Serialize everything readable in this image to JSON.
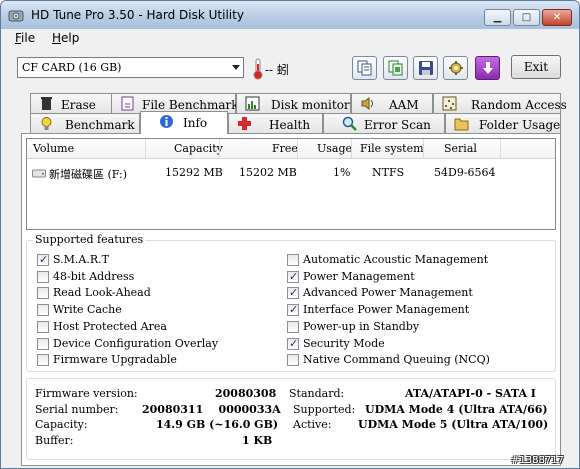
{
  "window": {
    "title": "HD Tune Pro 3.50 - Hard Disk Utility"
  },
  "menu": [
    {
      "label": "File",
      "key": "F",
      "rest": "ile"
    },
    {
      "label": "Help",
      "key": "H",
      "rest": "elp"
    }
  ],
  "toolbar": {
    "drive": "CF CARD (16 GB)",
    "temperature": "-- 蚓",
    "exit_label": "Exit",
    "buttons": [
      "copy-info-icon",
      "copy-screen-icon",
      "save-icon",
      "options-icon",
      "download-icon"
    ]
  },
  "tabs": {
    "row1": [
      {
        "label": "Erase",
        "icon": "trash-icon"
      },
      {
        "label": "File Benchmark",
        "icon": "file-benchmark-icon"
      },
      {
        "label": "Disk monitor",
        "icon": "disk-monitor-icon"
      },
      {
        "label": "AAM",
        "icon": "speaker-icon"
      },
      {
        "label": "Random Access",
        "icon": "random-access-icon"
      }
    ],
    "row2": [
      {
        "label": "Benchmark",
        "icon": "lightbulb-icon"
      },
      {
        "label": "Info",
        "icon": "info-icon",
        "active": true
      },
      {
        "label": "Health",
        "icon": "health-cross-icon"
      },
      {
        "label": "Error Scan",
        "icon": "magnifier-icon"
      },
      {
        "label": "Folder Usage",
        "icon": "folder-icon"
      }
    ]
  },
  "volumes": {
    "headers": [
      "Volume",
      "Capacity",
      "Free",
      "Usage",
      "File system",
      "Serial"
    ],
    "rows": [
      {
        "volume": "新增磁碟區 (F:)",
        "capacity": "15292 MB",
        "free": "15202 MB",
        "usage": "1%",
        "fs": "NTFS",
        "serial": "54D9-6564"
      }
    ]
  },
  "features": {
    "title": "Supported features",
    "left": [
      {
        "label": "S.M.A.R.T",
        "checked": true
      },
      {
        "label": "48-bit Address",
        "checked": false
      },
      {
        "label": "Read Look-Ahead",
        "checked": false
      },
      {
        "label": "Write Cache",
        "checked": false
      },
      {
        "label": "Host Protected Area",
        "checked": false
      },
      {
        "label": "Device Configuration Overlay",
        "checked": false
      },
      {
        "label": "Firmware Upgradable",
        "checked": false
      }
    ],
    "right": [
      {
        "label": "Automatic Acoustic Management",
        "checked": false
      },
      {
        "label": "Power Management",
        "checked": true
      },
      {
        "label": "Advanced Power Management",
        "checked": true
      },
      {
        "label": "Interface Power Management",
        "checked": true
      },
      {
        "label": "Power-up in Standby",
        "checked": false
      },
      {
        "label": "Security Mode",
        "checked": true
      },
      {
        "label": "Native Command Queuing (NCQ)",
        "checked": false
      }
    ]
  },
  "details": {
    "firmware_label": "Firmware version:",
    "firmware": "20080308",
    "serial_label": "Serial number:",
    "serial": "20080311    0000033A",
    "capacity_label": "Capacity:",
    "capacity": "14.9 GB (~16.0 GB)",
    "buffer_label": "Buffer:",
    "buffer": "1 KB",
    "standard_label": "Standard:",
    "standard": "ATA/ATAPI-0 - SATA I",
    "supported_label": "Supported:",
    "supported": "UDMA Mode 4 (Ultra ATA/66)",
    "active_label": "Active:",
    "active": "UDMA Mode 5 (Ultra ATA/100)"
  },
  "watermark": "#1388717"
}
